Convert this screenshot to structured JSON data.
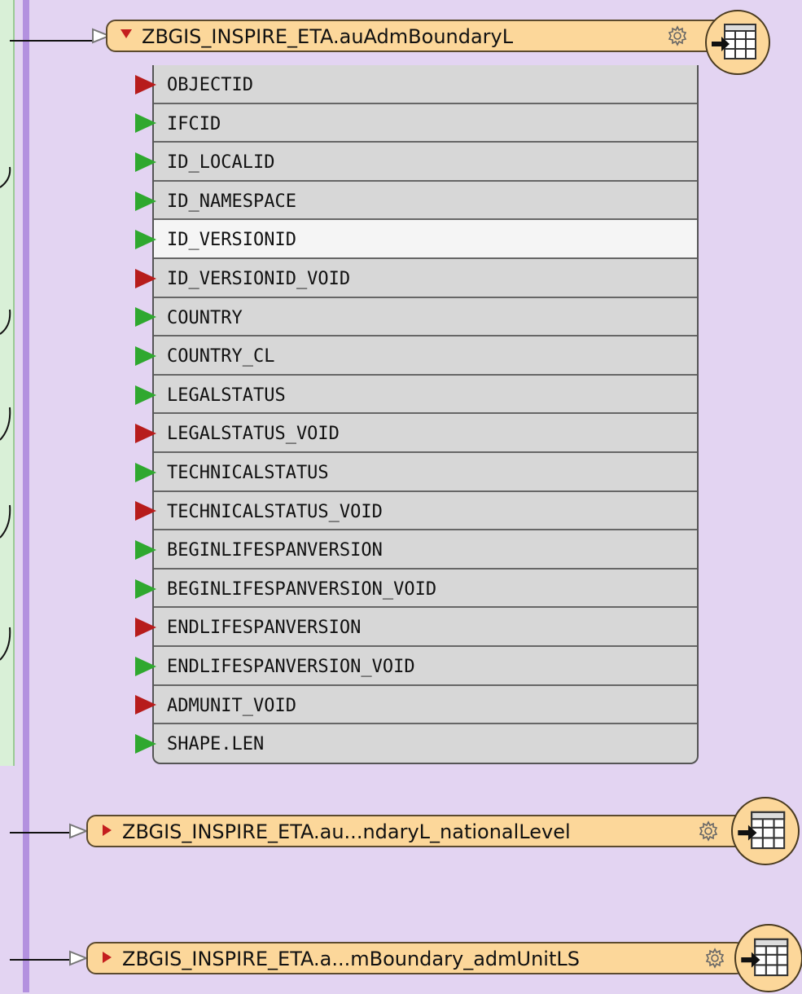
{
  "readers": [
    {
      "title": "ZBGIS_INSPIRE_ETA.auAdmBoundaryL",
      "expanded": true,
      "attributes": [
        {
          "name": "OBJECTID",
          "status": "red"
        },
        {
          "name": "IFCID",
          "status": "green"
        },
        {
          "name": "ID_LOCALID",
          "status": "green"
        },
        {
          "name": "ID_NAMESPACE",
          "status": "green"
        },
        {
          "name": "ID_VERSIONID",
          "status": "green",
          "selected": true
        },
        {
          "name": "ID_VERSIONID_VOID",
          "status": "red"
        },
        {
          "name": "COUNTRY",
          "status": "green"
        },
        {
          "name": "COUNTRY_CL",
          "status": "green"
        },
        {
          "name": "LEGALSTATUS",
          "status": "green"
        },
        {
          "name": "LEGALSTATUS_VOID",
          "status": "red"
        },
        {
          "name": "TECHNICALSTATUS",
          "status": "green"
        },
        {
          "name": "TECHNICALSTATUS_VOID",
          "status": "red"
        },
        {
          "name": "BEGINLIFESPANVERSION",
          "status": "green"
        },
        {
          "name": "BEGINLIFESPANVERSION_VOID",
          "status": "green"
        },
        {
          "name": "ENDLIFESPANVERSION",
          "status": "red"
        },
        {
          "name": "ENDLIFESPANVERSION_VOID",
          "status": "green"
        },
        {
          "name": "ADMUNIT_VOID",
          "status": "red"
        },
        {
          "name": "SHAPE.LEN",
          "status": "green"
        }
      ]
    },
    {
      "title": "ZBGIS_INSPIRE_ETA.au...ndaryL_nationalLevel",
      "expanded": false
    },
    {
      "title": "ZBGIS_INSPIRE_ETA.a...mBoundary_admUnitLS",
      "expanded": false
    }
  ],
  "icons": {
    "settings": "gear-icon",
    "reader": "reader-table-icon",
    "expand": "expand-triangle-icon",
    "collapse": "collapse-triangle-icon"
  },
  "colors": {
    "canvas": "#e3d4f2",
    "reader_header": "#fcd79a",
    "port_connected": "#2fa82f",
    "port_unconnected": "#b71c1c",
    "bookmark_green": "#d9f0d7",
    "bookmark_purple": "#b391df"
  }
}
